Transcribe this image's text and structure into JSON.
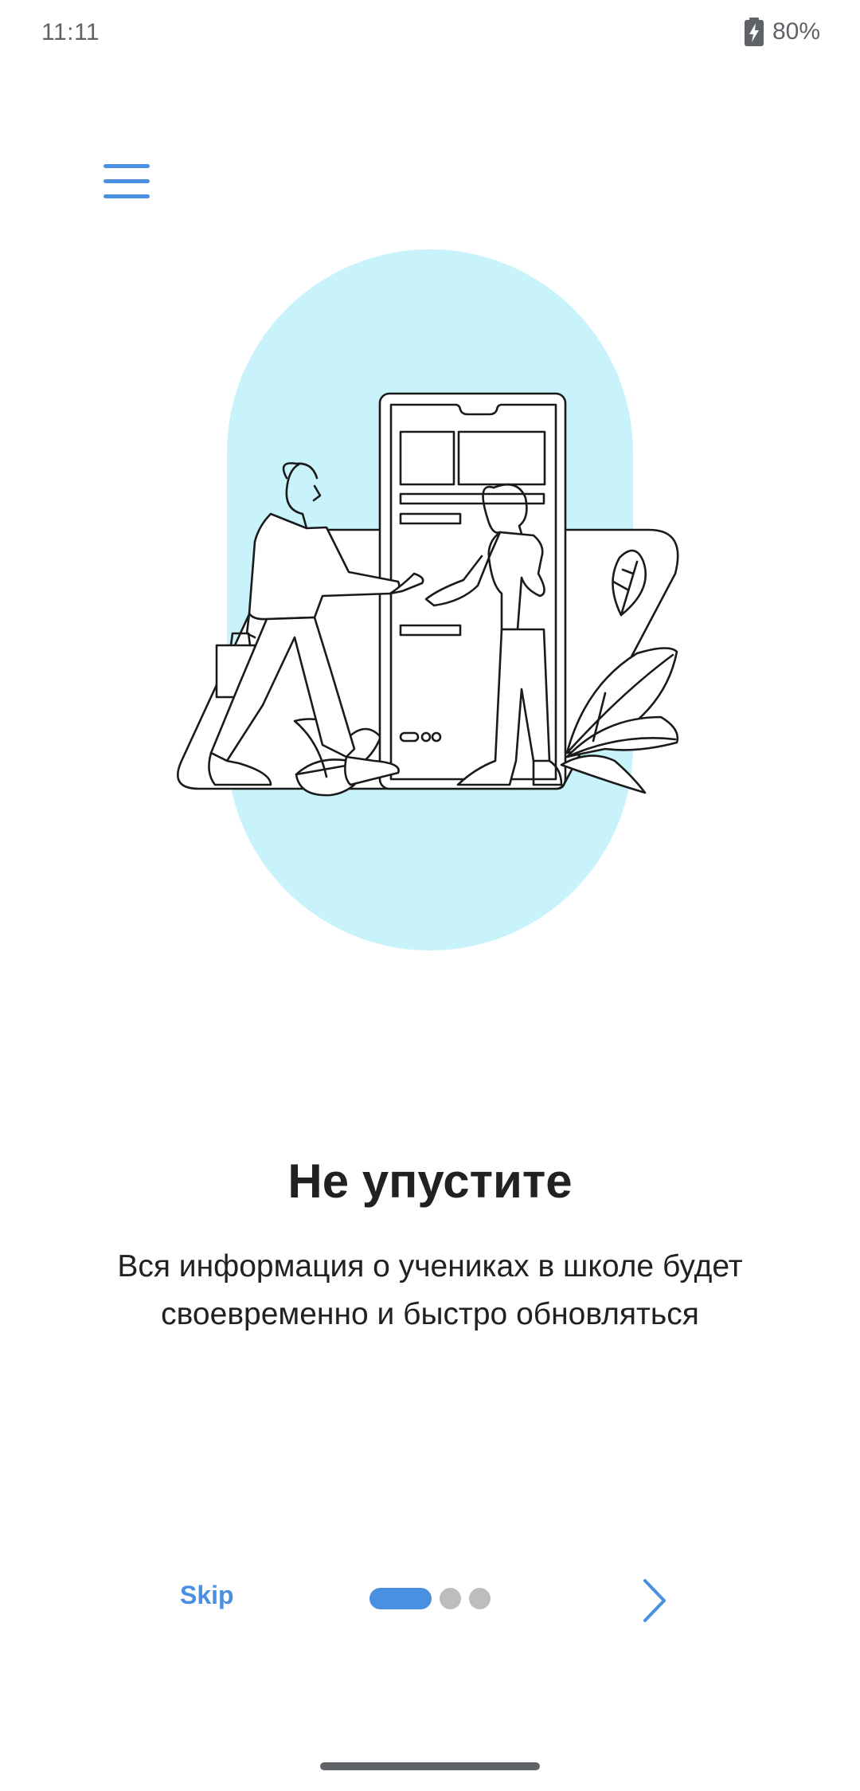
{
  "status_bar": {
    "time": "11:11",
    "battery_percent": "80%",
    "battery_icon": "battery-charging-icon"
  },
  "header": {
    "menu_icon": "hamburger-menu-icon"
  },
  "slide": {
    "title": "Не упустите",
    "description": "Вся информация о учениках в школе будет своевременно и быстро обновляться",
    "illustration": "two-people-handshake-phone-illustration"
  },
  "footer": {
    "skip_label": "Skip",
    "total_pages": 3,
    "current_page": 1,
    "next_icon": "chevron-right-icon"
  },
  "colors": {
    "accent": "#4a90e2",
    "illustration_bg": "#c9f3fb",
    "dot_inactive": "#bdbdbd",
    "text": "#212121"
  }
}
